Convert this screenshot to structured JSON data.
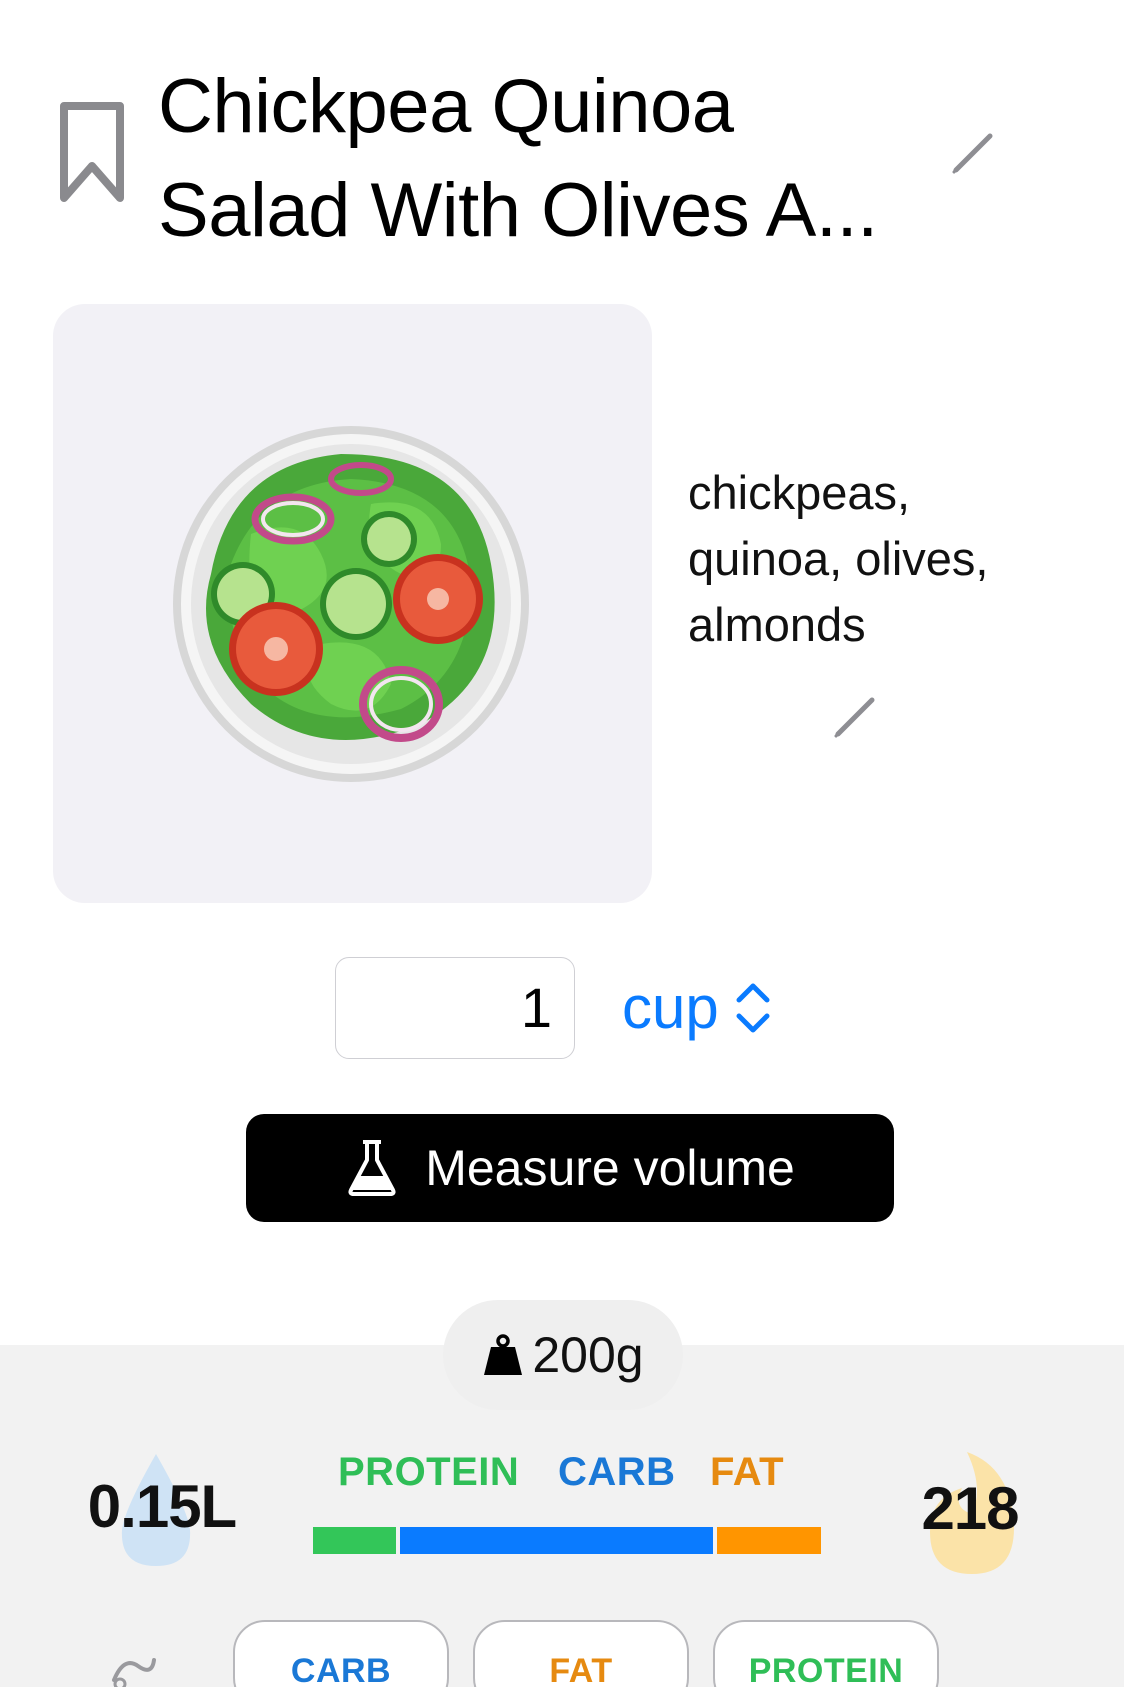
{
  "header": {
    "title_line1": "Chickpea Quinoa",
    "title_line2": "Salad With Olives A..."
  },
  "food": {
    "image_icon": "green-salad-emoji",
    "ingredients": "chickpeas, quinoa, olives, almonds"
  },
  "quantity": {
    "value": "1",
    "unit": "cup"
  },
  "measure_button": {
    "label": "Measure volume",
    "icon": "flask-icon"
  },
  "stats": {
    "weight": "200g",
    "water": "0.15L",
    "calories": "218",
    "macro_labels": {
      "protein": "PROTEIN",
      "carb": "CARB",
      "fat": "FAT"
    },
    "macro_bar_fractions": {
      "protein": 0.16,
      "carb": 0.6,
      "fat": 0.2
    }
  },
  "chips": [
    "CARB",
    "FAT",
    "PROTEIN"
  ],
  "colors": {
    "accent_blue": "#0a7bff",
    "protein_green": "#33c659",
    "carb_blue": "#0a7bff",
    "fat_orange": "#ff9500",
    "card_bg": "#f2f1f6",
    "stats_bg": "#f2f2f2"
  }
}
